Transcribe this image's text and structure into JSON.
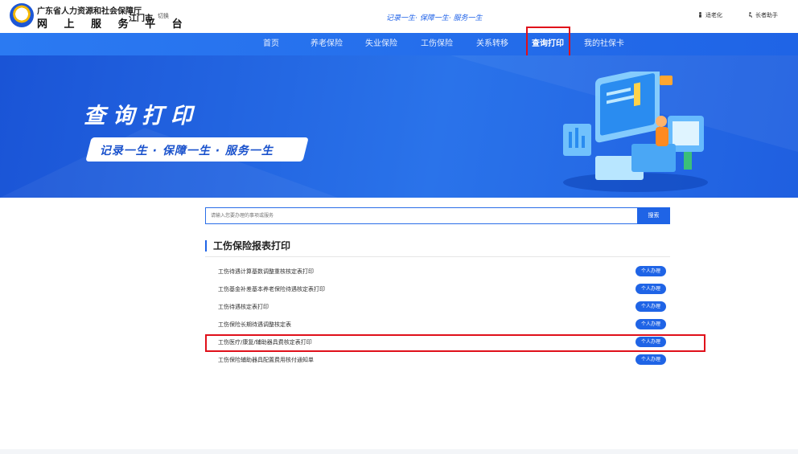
{
  "header": {
    "org": "广东省人力资源和社会保障厅",
    "platform": "网 上 服 务 平 台",
    "city": "江门市",
    "switch": "切换",
    "slogan": "记录一生· 保障一生· 服务一生",
    "tools": [
      "适老化",
      "长者助手"
    ]
  },
  "nav": {
    "items": [
      "首页",
      "养老保险",
      "失业保险",
      "工伤保险",
      "关系转移",
      "查询打印",
      "我的社保卡"
    ],
    "active": "查询打印"
  },
  "banner": {
    "title": "查询打印",
    "slogan": "记录一生 · 保障一生 · 服务一生"
  },
  "search": {
    "placeholder": "请输入您要办理的事项或服务",
    "button": "搜索"
  },
  "section": {
    "title": "工伤保险报表打印",
    "action_label": "个人办理",
    "rows": [
      "工伤待遇计算基数调整重核核定表打印",
      "工伤基金补差基本养老保险待遇核定表打印",
      "工伤待遇核定表打印",
      "工伤保险长期待遇调整核定表",
      "工伤医疗/康复/辅助器具费核定表打印",
      "工伤保险辅助器具配置费用核付通知单"
    ]
  },
  "colors": {
    "primary": "#1f64e6",
    "highlight": "#e0101a"
  }
}
